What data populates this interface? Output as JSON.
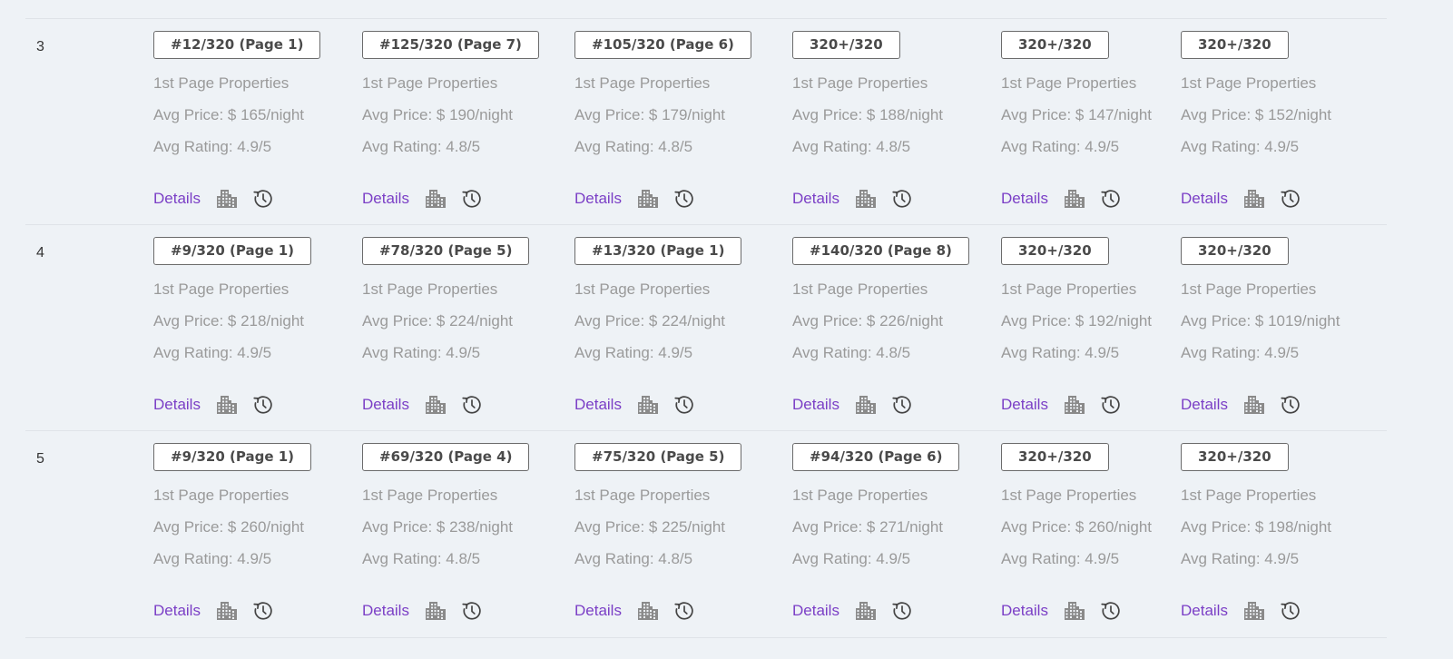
{
  "actions": {
    "details_label": "Details",
    "building_icon": "building-icon",
    "history_icon": "history-icon"
  },
  "colors": {
    "link": "#7b3fc6",
    "muted_text": "#9a9a9a",
    "badge_border": "#6b6b6b",
    "background": "#eef2f6"
  },
  "rows": [
    {
      "num": "3",
      "cells": [
        {
          "rank": "#12/320 (Page 1)",
          "label": "1st Page Properties",
          "price": "Avg Price: $ 165/night",
          "rating": "Avg Rating: 4.9/5"
        },
        {
          "rank": "#125/320 (Page 7)",
          "label": "1st Page Properties",
          "price": "Avg Price: $ 190/night",
          "rating": "Avg Rating: 4.8/5"
        },
        {
          "rank": "#105/320 (Page 6)",
          "label": "1st Page Properties",
          "price": "Avg Price: $ 179/night",
          "rating": "Avg Rating: 4.8/5"
        },
        {
          "rank": "320+/320",
          "label": "1st Page Properties",
          "price": "Avg Price: $ 188/night",
          "rating": "Avg Rating: 4.8/5"
        },
        {
          "rank": "320+/320",
          "label": "1st Page Properties",
          "price": "Avg Price: $ 147/night",
          "rating": "Avg Rating: 4.9/5"
        },
        {
          "rank": "320+/320",
          "label": "1st Page Properties",
          "price": "Avg Price: $ 152/night",
          "rating": "Avg Rating: 4.9/5"
        }
      ]
    },
    {
      "num": "4",
      "cells": [
        {
          "rank": "#9/320 (Page 1)",
          "label": "1st Page Properties",
          "price": "Avg Price: $ 218/night",
          "rating": "Avg Rating: 4.9/5"
        },
        {
          "rank": "#78/320 (Page 5)",
          "label": "1st Page Properties",
          "price": "Avg Price: $ 224/night",
          "rating": "Avg Rating: 4.9/5"
        },
        {
          "rank": "#13/320 (Page 1)",
          "label": "1st Page Properties",
          "price": "Avg Price: $ 224/night",
          "rating": "Avg Rating: 4.9/5"
        },
        {
          "rank": "#140/320 (Page 8)",
          "label": "1st Page Properties",
          "price": "Avg Price: $ 226/night",
          "rating": "Avg Rating: 4.8/5"
        },
        {
          "rank": "320+/320",
          "label": "1st Page Properties",
          "price": "Avg Price: $ 192/night",
          "rating": "Avg Rating: 4.9/5"
        },
        {
          "rank": "320+/320",
          "label": "1st Page Properties",
          "price": "Avg Price: $ 1019/night",
          "rating": "Avg Rating: 4.9/5"
        }
      ]
    },
    {
      "num": "5",
      "cells": [
        {
          "rank": "#9/320 (Page 1)",
          "label": "1st Page Properties",
          "price": "Avg Price: $ 260/night",
          "rating": "Avg Rating: 4.9/5"
        },
        {
          "rank": "#69/320 (Page 4)",
          "label": "1st Page Properties",
          "price": "Avg Price: $ 238/night",
          "rating": "Avg Rating: 4.8/5"
        },
        {
          "rank": "#75/320 (Page 5)",
          "label": "1st Page Properties",
          "price": "Avg Price: $ 225/night",
          "rating": "Avg Rating: 4.8/5"
        },
        {
          "rank": "#94/320 (Page 6)",
          "label": "1st Page Properties",
          "price": "Avg Price: $ 271/night",
          "rating": "Avg Rating: 4.9/5"
        },
        {
          "rank": "320+/320",
          "label": "1st Page Properties",
          "price": "Avg Price: $ 260/night",
          "rating": "Avg Rating: 4.9/5"
        },
        {
          "rank": "320+/320",
          "label": "1st Page Properties",
          "price": "Avg Price: $ 198/night",
          "rating": "Avg Rating: 4.9/5"
        }
      ]
    }
  ]
}
